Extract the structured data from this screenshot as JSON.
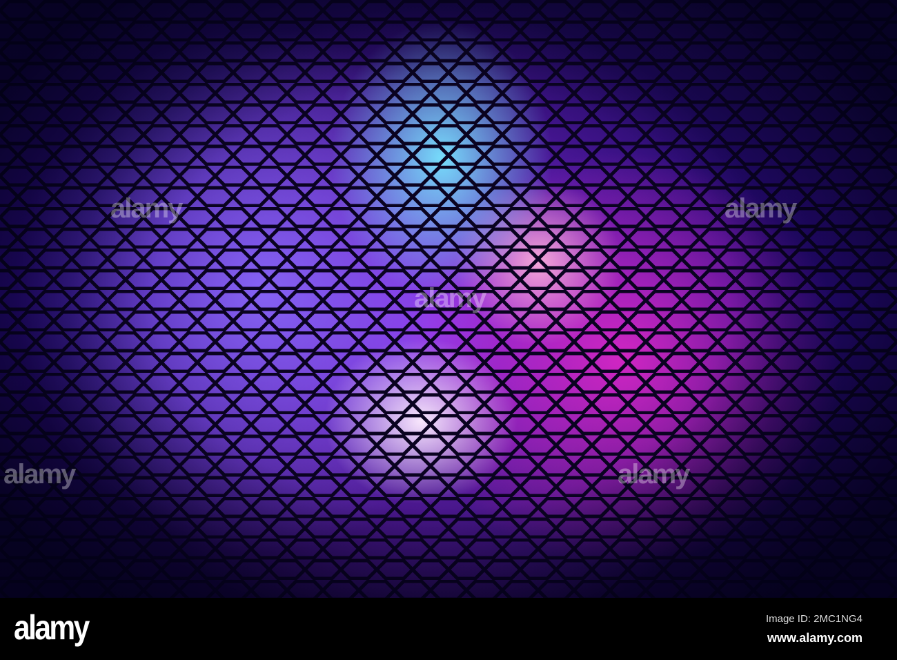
{
  "watermark": {
    "logo": "alamy",
    "image_id": "Image ID: 2MC1NG4",
    "site": "www.alamy.com"
  },
  "colors": {
    "cyan": "#78e6ff",
    "magenta": "#e628c8",
    "violet": "#8c6eff",
    "dark": "#14053a"
  }
}
